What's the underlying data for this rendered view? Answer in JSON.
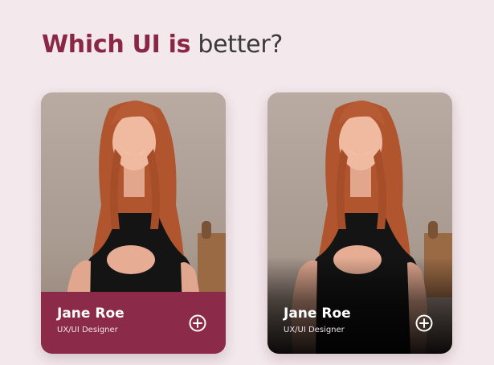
{
  "headline": {
    "accent_text": "Which UI is",
    "plain_text": " better?"
  },
  "colors": {
    "accent": "#8a2746",
    "card_footer": "#8c2a49",
    "background": "#f3e8ec"
  },
  "cards": [
    {
      "style": "solid-footer",
      "name": "Jane Roe",
      "role": "UX/UI Designer",
      "action_icon": "plus-circle-icon"
    },
    {
      "style": "gradient-footer",
      "name": "Jane Roe",
      "role": "UX/UI Designer",
      "action_icon": "plus-circle-icon"
    }
  ]
}
